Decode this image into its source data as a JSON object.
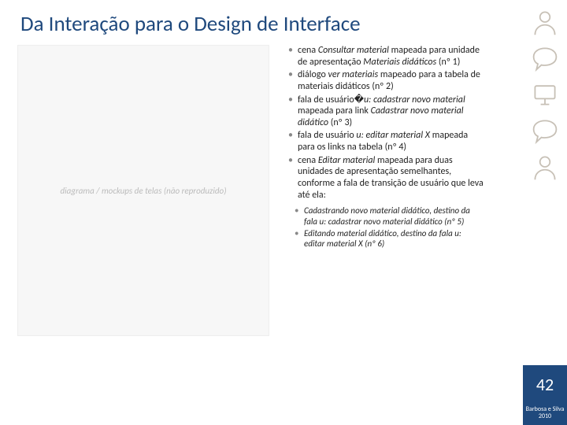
{
  "title": "Da Interação para o Design de Interface",
  "bullets": [
    "cena <em>Consultar material</em> mapeada para unidade de apresentação <em>Materiais didáticos</em> (nº 1)",
    "diálogo <em>ver materiais</em> mapeado para a tabela de materiais didáticos (nº 2)",
    "fala de usuário�<em>u: cadastrar novo material</em> mapeada para link <em>Cadastrar novo material didático</em> (nº 3)",
    "fala de usuário <em>u: editar material X</em> mapeada para os links na tabela (nº 4)",
    "cena <em>Editar material</em> mapeada para duas unidades de apresentação semelhantes, conforme a fala de transição de usuário que leva até ela:"
  ],
  "sub_bullets": [
    "<em>Cadastrando novo material didático</em>, destino da fala <em>u: cadastrar novo material didático</em> (nº 5)",
    "<em>Editando material didático</em>, destino da fala <em>u: editar material X</em> (nº 6)"
  ],
  "figure_alt": "diagrama / mockups de telas (não reproduzido)",
  "page_number": "42",
  "citation": "Barbosa e Silva 2010",
  "icons": [
    "person-icon",
    "speech-icon",
    "monitor-icon",
    "speech-icon",
    "person-icon"
  ]
}
